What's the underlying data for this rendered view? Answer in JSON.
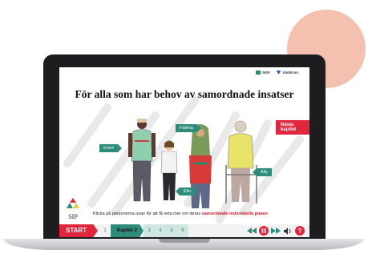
{
  "header": {
    "logos": [
      "SKR",
      "VästKom"
    ]
  },
  "main": {
    "title": "För alla som har behov av samordnade insatser",
    "next_chapter": "Nästa kapitel",
    "people": [
      "Evert",
      "Fatima",
      "Elin",
      "Ally"
    ]
  },
  "sip": {
    "label": "SIP"
  },
  "instruction": {
    "prefix": "Klicka på personerna ovan för att få veta mer om deras ",
    "highlight": "samordnade individuella planer"
  },
  "nav": {
    "start": "START",
    "chapters": [
      "1",
      "Kapitel 2",
      "3",
      "4",
      "5",
      "6"
    ],
    "active_chapter_index": 1
  },
  "colors": {
    "accent_red": "#e0263c",
    "accent_teal": "#2e8c7a",
    "blob": "#f4c0b0"
  },
  "icons": [
    "rewind-icon",
    "pause-icon",
    "forward-icon",
    "volume-icon",
    "help-icon"
  ]
}
